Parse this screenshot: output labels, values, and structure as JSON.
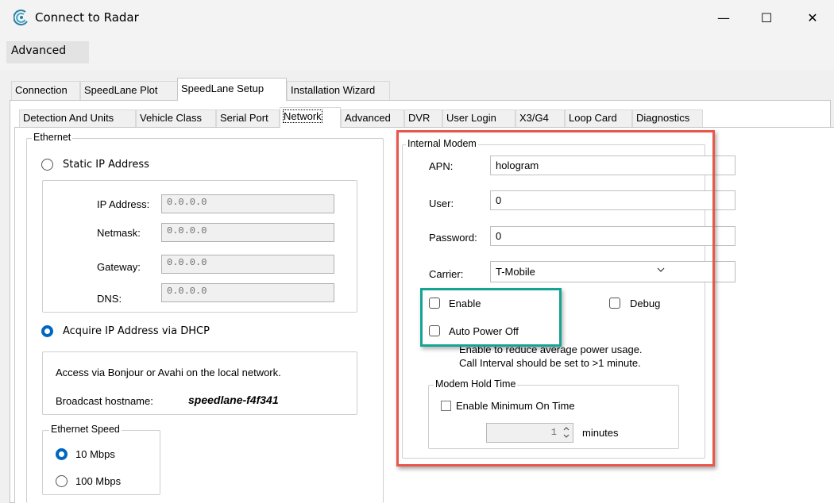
{
  "window": {
    "title": "Connect to Radar",
    "controls": {
      "minimize": "—",
      "maximize": "☐",
      "close": "✕"
    }
  },
  "menu": {
    "advanced": "Advanced"
  },
  "main_tabs": [
    {
      "label": "Connection"
    },
    {
      "label": "SpeedLane Plot"
    },
    {
      "label": "SpeedLane Setup",
      "active": true
    },
    {
      "label": "Installation Wizard"
    }
  ],
  "sub_tabs": [
    {
      "label": "Detection And Units"
    },
    {
      "label": "Vehicle Class"
    },
    {
      "label": "Serial Port"
    },
    {
      "label": "Network",
      "active": true
    },
    {
      "label": "Advanced"
    },
    {
      "label": "DVR"
    },
    {
      "label": "User Login"
    },
    {
      "label": "X3/G4"
    },
    {
      "label": "Loop Card"
    },
    {
      "label": "Diagnostics"
    }
  ],
  "ethernet": {
    "legend": "Ethernet",
    "static_ip": {
      "label": "Static IP Address",
      "selected": false
    },
    "ip_address": {
      "label": "IP Address:",
      "value": "0.0.0.0"
    },
    "netmask": {
      "label": "Netmask:",
      "value": "0.0.0.0"
    },
    "gateway": {
      "label": "Gateway:",
      "value": "0.0.0.0"
    },
    "dns": {
      "label": "DNS:",
      "value": "0.0.0.0"
    },
    "dhcp": {
      "label": "Acquire IP Address via DHCP",
      "selected": true
    },
    "bonjour_text": "Access via Bonjour or Avahi on the local network.",
    "hostname_label": "Broadcast hostname:",
    "hostname_value": "speedlane-f4f341",
    "speed": {
      "legend": "Ethernet Speed",
      "mbps10": {
        "label": "10 Mbps",
        "selected": true
      },
      "mbps100": {
        "label": "100 Mbps",
        "selected": false
      }
    }
  },
  "modem": {
    "legend": "Internal Modem",
    "apn": {
      "label": "APN:",
      "value": "hologram"
    },
    "user": {
      "label": "User:",
      "value": "0"
    },
    "password": {
      "label": "Password:",
      "value": "0"
    },
    "carrier": {
      "label": "Carrier:",
      "value": "T-Mobile"
    },
    "enable": {
      "label": "Enable",
      "checked": false
    },
    "debug": {
      "label": "Debug",
      "checked": false
    },
    "auto_power_off": {
      "label": "Auto Power Off",
      "checked": false
    },
    "hint_line1": "Enable to reduce average power usage.",
    "hint_line2": "Call Interval should be set to >1 minute.",
    "hold": {
      "legend": "Modem Hold Time",
      "enable_min": {
        "label": "Enable Minimum On Time",
        "checked": false
      },
      "minutes_value": "1",
      "minutes_label": "minutes"
    }
  },
  "colors": {
    "accent": "#0067c0",
    "highlight_red": "#e8574a",
    "highlight_green": "#16a394"
  }
}
